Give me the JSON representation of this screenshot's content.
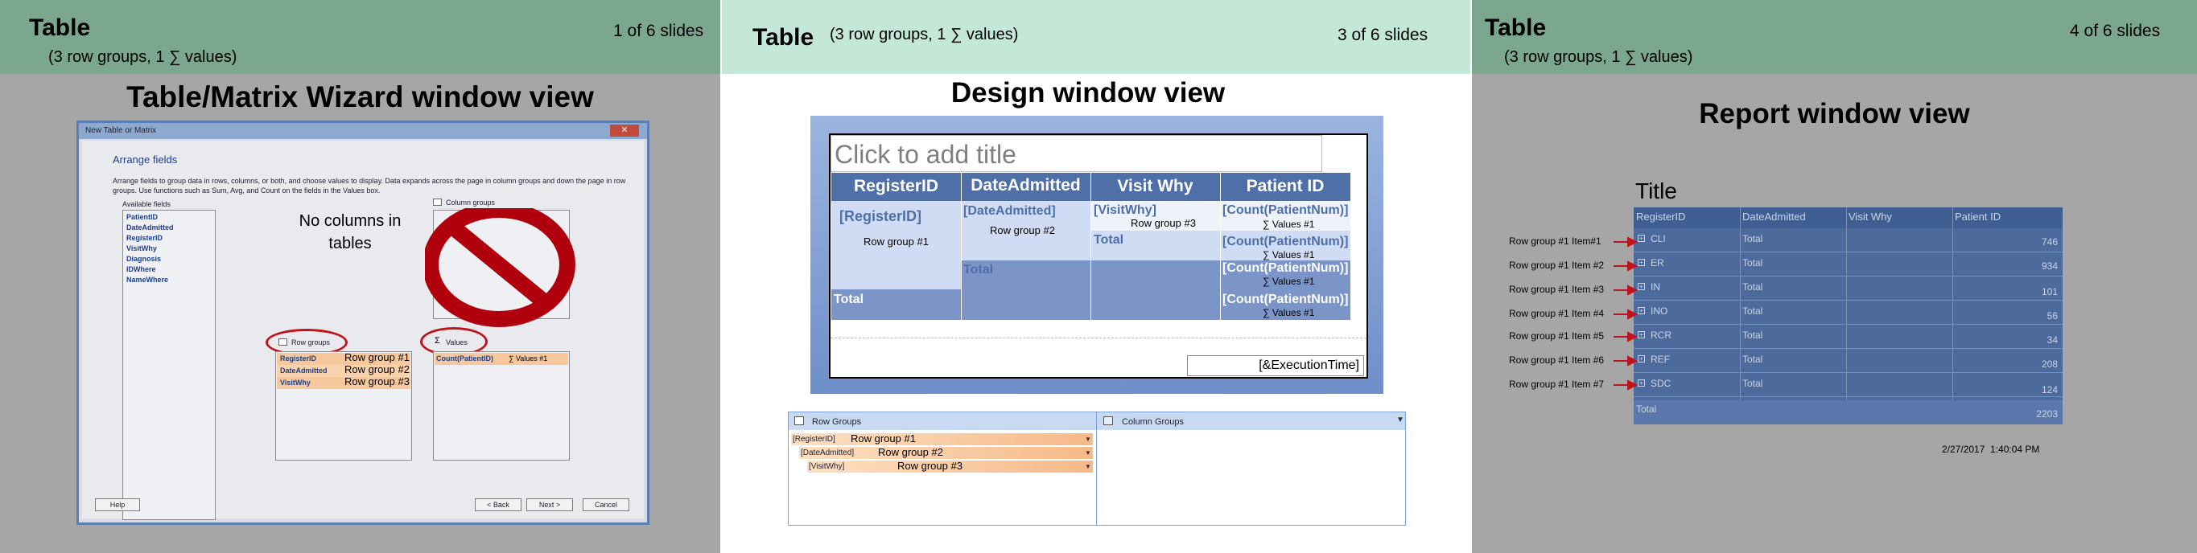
{
  "slides": [
    {
      "title": "Table",
      "subtitle": "(3 row groups, 1 ∑ values)",
      "counter": "1 of 6 slides",
      "heading": "Table/Matrix Wizard window view"
    },
    {
      "title": "Table",
      "subtitle": "(3 row groups, 1 ∑ values)",
      "counter": "3 of 6 slides",
      "heading": "Design window view"
    },
    {
      "title": "Table",
      "subtitle": "(3 row groups, 1 ∑ values)",
      "counter": "4 of 6 slides",
      "heading": "Report window view"
    }
  ],
  "wizard": {
    "window_title": "New Table or Matrix",
    "section": "Arrange fields",
    "instructions": "Arrange fields to group data in rows, columns, or both, and choose values to display. Data expands across the page in column groups and down the page in row groups.  Use functions such as Sum, Avg, and Count on the fields in the Values box.",
    "available_label": "Available fields",
    "fields": [
      "PatientID",
      "DateAdmitted",
      "RegisterID",
      "VisitWhy",
      "Diagnosis",
      "IDWhere",
      "NameWhere"
    ],
    "column_groups_label": "Column groups",
    "row_groups_label": "Row groups",
    "values_label": "Values",
    "row_groups": [
      "RegisterID",
      "DateAdmitted",
      "VisitWhy"
    ],
    "row_group_notes": [
      "Row group #1",
      "Row group #2",
      "Row group #3"
    ],
    "value_item": "Count(PatientID)",
    "value_note": "∑ Values #1",
    "no_columns_note": "No columns in tables",
    "buttons": {
      "help": "Help",
      "back": "< Back",
      "next": "Next >",
      "cancel": "Cancel"
    }
  },
  "design": {
    "title_placeholder": "Click to add title",
    "headers": [
      "RegisterID",
      "DateAdmitted",
      "Visit Why",
      "Patient ID"
    ],
    "cells": {
      "register": "[RegisterID]",
      "rg1": "Row group #1",
      "date": "[DateAdmitted]",
      "rg2": "Row group #2",
      "visit": "[VisitWhy]",
      "rg3": "Row group #3",
      "count": "[Count(PatientNum)]",
      "val": "∑ Values #1",
      "total": "Total"
    },
    "execution_time": "[&ExecutionTime]",
    "row_groups_label": "Row Groups",
    "column_groups_label": "Column Groups",
    "pane_groups": [
      {
        "name": "[RegisterID]",
        "note": "Row group #1"
      },
      {
        "name": "[DateAdmitted]",
        "note": "Row group #2"
      },
      {
        "name": "[VisitWhy]",
        "note": "Row group #3"
      }
    ]
  },
  "report": {
    "title": "Title",
    "headers": [
      "RegisterID",
      "DateAdmitted",
      "Visit Why",
      "Patient ID"
    ],
    "rows": [
      {
        "reg": "CLI",
        "date": "Total",
        "count": "746",
        "note": "Row group #1 Item#1"
      },
      {
        "reg": "ER",
        "date": "Total",
        "count": "934",
        "note": "Row group #1 Item #2"
      },
      {
        "reg": "IN",
        "date": "Total",
        "count": "101",
        "note": "Row group #1 Item #3"
      },
      {
        "reg": "INO",
        "date": "Total",
        "count": "56",
        "note": "Row group #1 Item #4"
      },
      {
        "reg": "RCR",
        "date": "Total",
        "count": "34",
        "note": "Row group #1 Item #5"
      },
      {
        "reg": "REF",
        "date": "Total",
        "count": "208",
        "note": "Row group #1 Item #6"
      },
      {
        "reg": "SDC",
        "date": "Total",
        "count": "124",
        "note": "Row group #1 Item #7"
      }
    ],
    "grand_total_label": "Total",
    "grand_total": "2203",
    "timestamp": "2/27/2017  1:40:04 PM"
  },
  "colors": {
    "header_green": "#7aa78e",
    "header_mint": "#c3e8d8",
    "gray_bg": "#a6a6a6",
    "design_dark": "#4f6fa8",
    "design_mid": "#7b95c9",
    "design_light": "#cfdcf3",
    "arrow_red": "#c0141c"
  }
}
